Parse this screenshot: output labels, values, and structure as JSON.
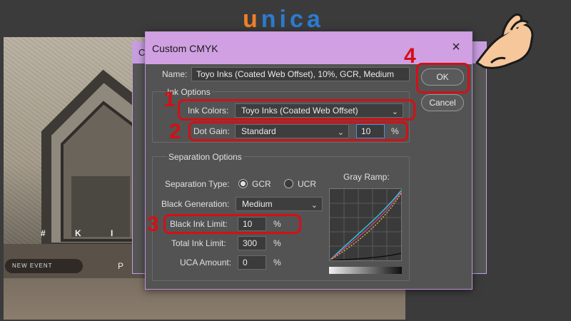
{
  "logo": {
    "prefix": "u",
    "rest": "nica"
  },
  "background": {
    "poster_text": "# K I M T",
    "event_label": "NEW EVENT",
    "char": "P"
  },
  "back_dialog": {
    "title_char": "C"
  },
  "dialog": {
    "title": "Custom CMYK",
    "close_symbol": "×",
    "name_label": "Name:",
    "name_value": "Toyo Inks (Coated Web Offset), 10%, GCR, Medium",
    "ink_options": {
      "title": "Ink Options",
      "ink_colors_label": "Ink Colors:",
      "ink_colors_value": "Toyo Inks (Coated Web Offset)",
      "dot_gain_label": "Dot Gain:",
      "dot_gain_value": "Standard",
      "dot_gain_percent": "10",
      "percent_sign": "%"
    },
    "separation_options": {
      "title": "Separation Options",
      "separation_type_label": "Separation Type:",
      "gcr_label": "GCR",
      "ucr_label": "UCR",
      "black_generation_label": "Black Generation:",
      "black_generation_value": "Medium",
      "black_ink_limit_label": "Black Ink Limit:",
      "black_ink_limit_value": "10",
      "total_ink_limit_label": "Total Ink Limit:",
      "total_ink_limit_value": "300",
      "uca_amount_label": "UCA Amount:",
      "uca_amount_value": "0",
      "percent_sign": "%",
      "gray_ramp_label": "Gray Ramp:"
    },
    "buttons": {
      "ok": "OK",
      "cancel": "Cancel"
    }
  },
  "annotations": [
    "1",
    "2",
    "3",
    "4"
  ],
  "colors": {
    "annotation_red": "#d31016",
    "titlebar": "#d0a0e3",
    "dialog_bg": "#535353",
    "logo_blue": "#2b7bd0",
    "logo_orange": "#f0802a"
  }
}
